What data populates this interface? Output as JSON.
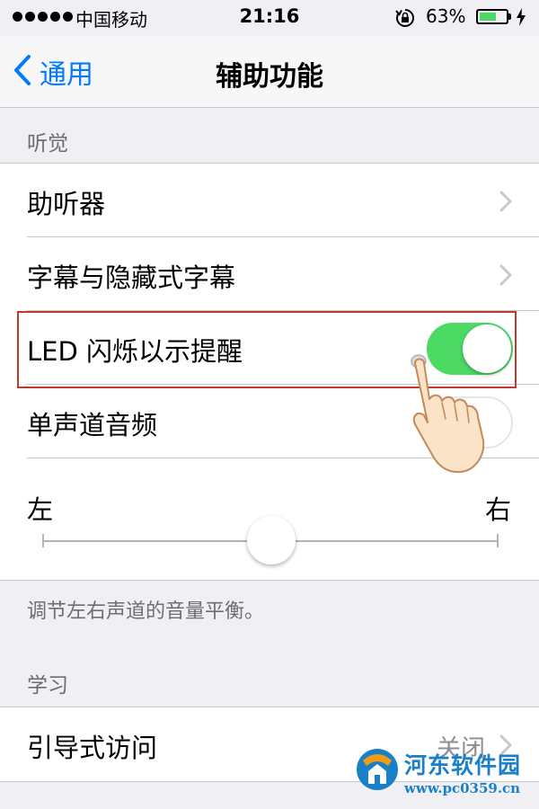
{
  "status_bar": {
    "carrier": "中国移动",
    "time": "21:16",
    "battery_percent": "63%",
    "battery_level": 0.63,
    "signal_bars": 5
  },
  "nav": {
    "back_label": "通用",
    "title": "辅助功能"
  },
  "hearing": {
    "header": "听觉",
    "items": [
      {
        "label": "助听器",
        "accessory": "chevron"
      },
      {
        "label": "字幕与隐藏式字幕",
        "accessory": "chevron"
      },
      {
        "label": "LED 闪烁以示提醒",
        "accessory": "toggle",
        "on": true
      },
      {
        "label": "单声道音频",
        "accessory": "toggle",
        "on": false
      }
    ],
    "balance": {
      "left_label": "左",
      "right_label": "右",
      "value": 0.5
    },
    "footer": "调节左右声道的音量平衡。"
  },
  "learning": {
    "header": "学习",
    "items": [
      {
        "label": "引导式访问",
        "value": "关闭",
        "accessory": "chevron"
      }
    ]
  },
  "watermark": {
    "title": "河东软件园",
    "url": "www.pc0359.cn"
  },
  "colors": {
    "accent": "#007aff",
    "toggle_on": "#4cd964",
    "highlight": "#c0392b",
    "background": "#efeff4"
  }
}
